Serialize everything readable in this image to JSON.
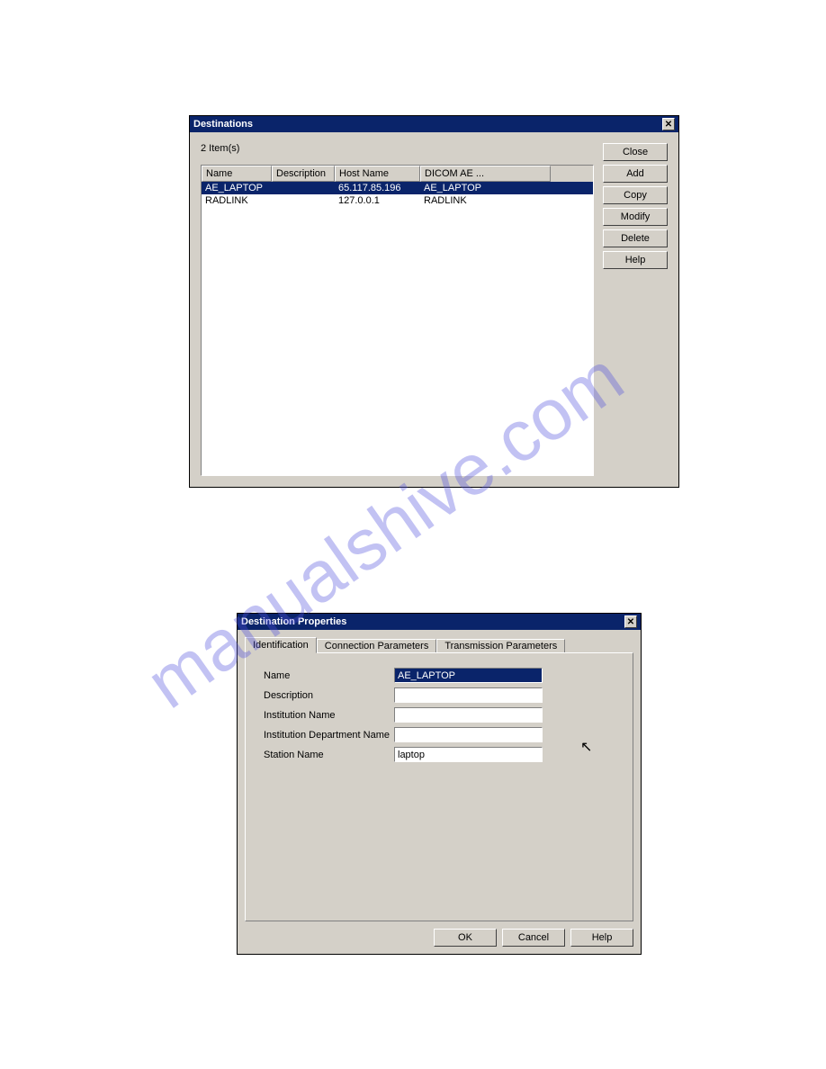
{
  "watermark": "manualshive.com",
  "destinations": {
    "title": "Destinations",
    "item_count": "2 Item(s)",
    "columns": {
      "name": "Name",
      "description": "Description",
      "host": "Host Name",
      "dicom": "DICOM AE ..."
    },
    "rows": [
      {
        "name": "AE_LAPTOP",
        "description": "",
        "host": "65.117.85.196",
        "dicom": "AE_LAPTOP",
        "selected": true
      },
      {
        "name": "RADLINK",
        "description": "",
        "host": "127.0.0.1",
        "dicom": "RADLINK",
        "selected": false
      }
    ],
    "buttons": {
      "close": "Close",
      "add": "Add",
      "copy": "Copy",
      "modify": "Modify",
      "delete": "Delete",
      "help": "Help"
    }
  },
  "properties": {
    "title": "Destination Properties",
    "tabs": {
      "identification": "Identification",
      "connection": "Connection Parameters",
      "transmission": "Transmission Parameters"
    },
    "fields": {
      "name_label": "Name",
      "name_value": "AE_LAPTOP",
      "description_label": "Description",
      "description_value": "",
      "institution_label": "Institution Name",
      "institution_value": "",
      "department_label": "Institution Department Name",
      "department_value": "",
      "station_label": "Station Name",
      "station_value": "laptop"
    },
    "buttons": {
      "ok": "OK",
      "cancel": "Cancel",
      "help": "Help"
    }
  }
}
